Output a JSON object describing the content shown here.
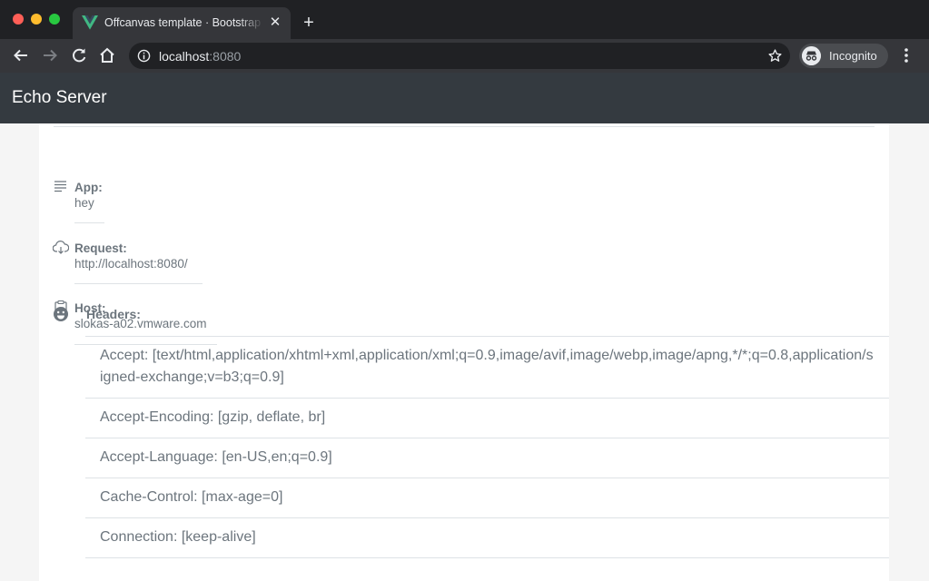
{
  "browser": {
    "tab_title": "Offcanvas template · Bootstrap",
    "url_host": "localhost",
    "url_port": ":8080",
    "profile_label": "Incognito"
  },
  "navbar": {
    "brand": "Echo Server"
  },
  "info": {
    "app": {
      "label": "App:",
      "value": "hey"
    },
    "request": {
      "label": "Request:",
      "value": "http://localhost:8080/"
    },
    "host": {
      "label": "Host:",
      "value": "slokas-a02.vmware.com"
    }
  },
  "headers": {
    "label": "Headers:",
    "items": [
      "Accept: [text/html,application/xhtml+xml,application/xml;q=0.9,image/avif,image/webp,image/apng,*/*;q=0.8,application/signed-exchange;v=b3;q=0.9]",
      "Accept-Encoding: [gzip, deflate, br]",
      "Accept-Language: [en-US,en;q=0.9]",
      "Cache-Control: [max-age=0]",
      "Connection: [keep-alive]"
    ]
  },
  "icons": {
    "app": "notes-icon",
    "request": "cloud-download-icon",
    "host": "clipboard-check-icon",
    "headers": "smiley-face-icon"
  },
  "colors": {
    "navbar": "#343a40",
    "text_muted": "#6c757d",
    "chrome_dark": "#202124",
    "chrome_toolbar": "#35363a",
    "vue_green": "#41b883"
  }
}
